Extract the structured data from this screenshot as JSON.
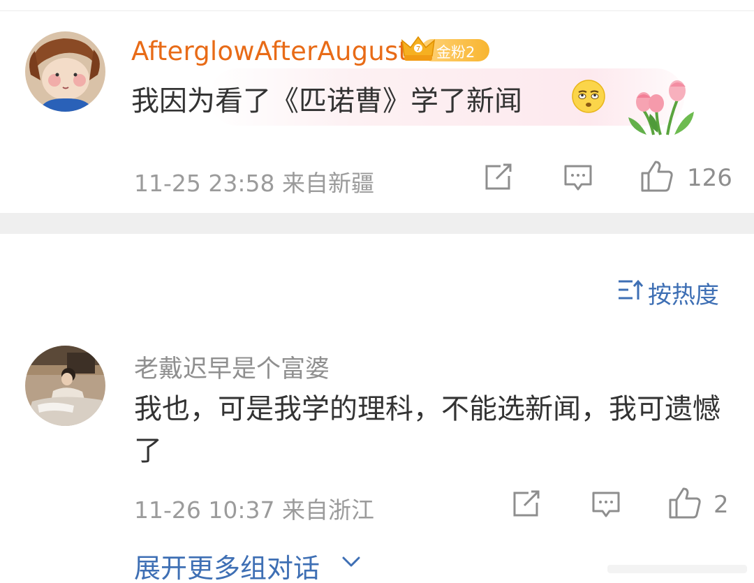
{
  "comment": {
    "username": "AfterglowAfterAugust",
    "badge_label": "金粉2",
    "text": "我因为看了《匹诺曹》学了新闻",
    "emoji": "eye-roll-emoji",
    "decoration": "tulips",
    "time": "11-25 23:58",
    "location": "来自新疆",
    "like_count": "126",
    "name_color": "#e86b17"
  },
  "sort": {
    "label": "按热度",
    "icon": "sort-icon"
  },
  "reply": {
    "username": "老戴迟早是个富婆",
    "text": "我也，可是我学的理科，不能选新闻，我可遗憾了",
    "time": "11-26 10:37",
    "location": "来自浙江",
    "like_count": "2"
  },
  "expand": {
    "label": "展开更多组对话",
    "icon": "chevron-down-icon"
  },
  "colors": {
    "link_blue": "#3e6fb4",
    "meta_gray": "#9b9b9b",
    "divider_band": "#efefef"
  }
}
